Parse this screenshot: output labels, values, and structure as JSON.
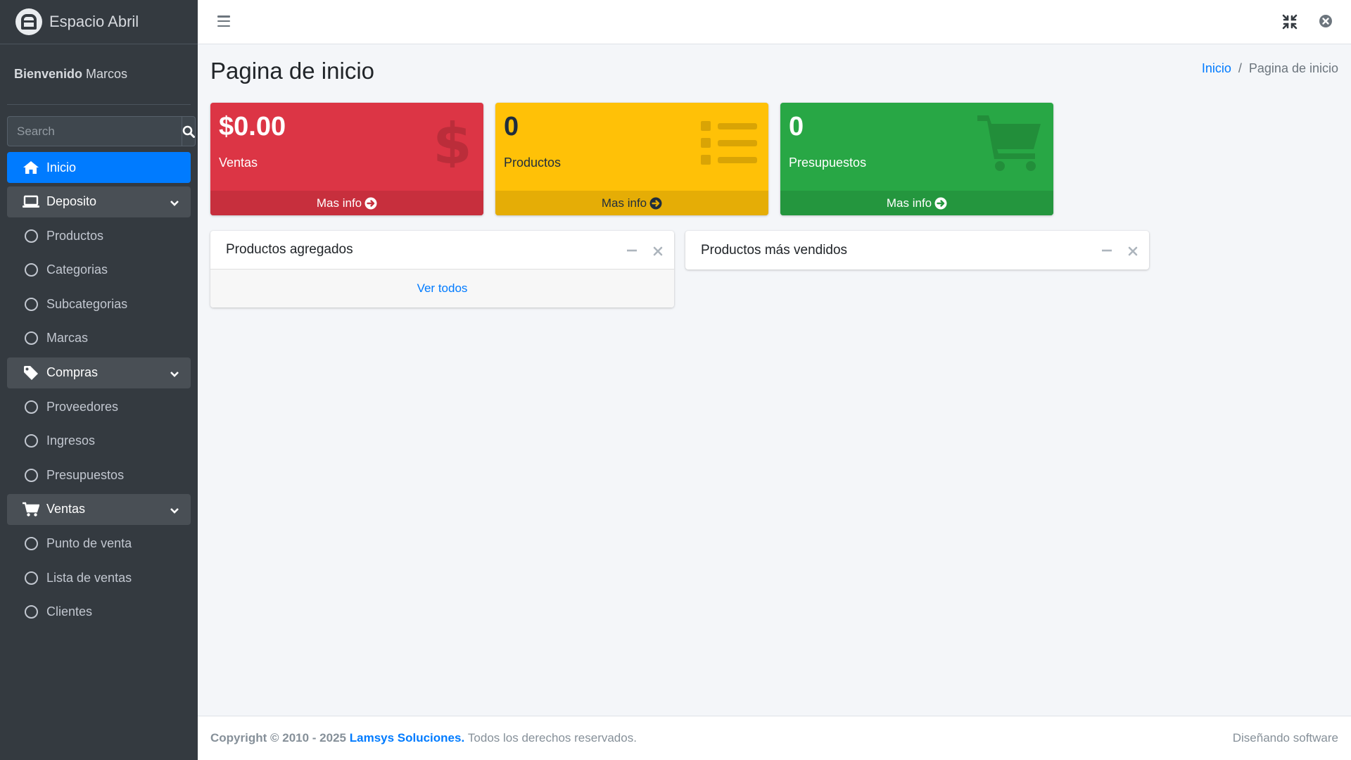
{
  "brand": {
    "name": "Espacio Abril"
  },
  "user_panel": {
    "greeting": "Bienvenido",
    "user_name": "Marcos"
  },
  "search": {
    "placeholder": "Search"
  },
  "sidebar": {
    "items": [
      {
        "label": "Inicio",
        "icon": "home-icon",
        "state": "active"
      },
      {
        "label": "Deposito",
        "icon": "laptop-icon",
        "state": "open"
      },
      {
        "label": "Productos",
        "icon": "circle-icon"
      },
      {
        "label": "Categorias",
        "icon": "circle-icon"
      },
      {
        "label": "Subcategorias",
        "icon": "circle-icon"
      },
      {
        "label": "Marcas",
        "icon": "circle-icon"
      },
      {
        "label": "Compras",
        "icon": "tag-icon",
        "state": "open"
      },
      {
        "label": "Proveedores",
        "icon": "circle-icon"
      },
      {
        "label": "Ingresos",
        "icon": "circle-icon"
      },
      {
        "label": "Presupuestos",
        "icon": "circle-icon"
      },
      {
        "label": "Ventas",
        "icon": "cart-icon",
        "state": "open"
      },
      {
        "label": "Punto de venta",
        "icon": "circle-icon"
      },
      {
        "label": "Lista de ventas",
        "icon": "circle-icon"
      },
      {
        "label": "Clientes",
        "icon": "circle-icon"
      }
    ]
  },
  "header": {
    "title": "Pagina de inicio"
  },
  "breadcrumb": {
    "home": "Inicio",
    "separator": "/",
    "current": "Pagina de inicio"
  },
  "stats": [
    {
      "value": "$0.00",
      "label": "Ventas",
      "link": "Mas info",
      "color": "#dc3545",
      "icon": "dollar-icon"
    },
    {
      "value": "0",
      "label": "Productos",
      "link": "Mas info",
      "color": "#ffc107",
      "icon": "list-icon"
    },
    {
      "value": "0",
      "label": "Presupuestos",
      "link": "Mas info",
      "color": "#28a745",
      "icon": "cart-icon"
    }
  ],
  "cards": {
    "added": {
      "title": "Productos agregados",
      "footer_link": "Ver todos"
    },
    "top_selling": {
      "title": "Productos más vendidos"
    }
  },
  "footer": {
    "copyright": "Copyright © 2010 - 2025",
    "company": "Lamsys Soluciones.",
    "rights": "Todos los derechos reservados.",
    "right_text": "Diseñando software"
  },
  "colors": {
    "sidebar_bg": "#343a40",
    "accent": "#007bff",
    "page_bg": "#f4f6f9"
  }
}
